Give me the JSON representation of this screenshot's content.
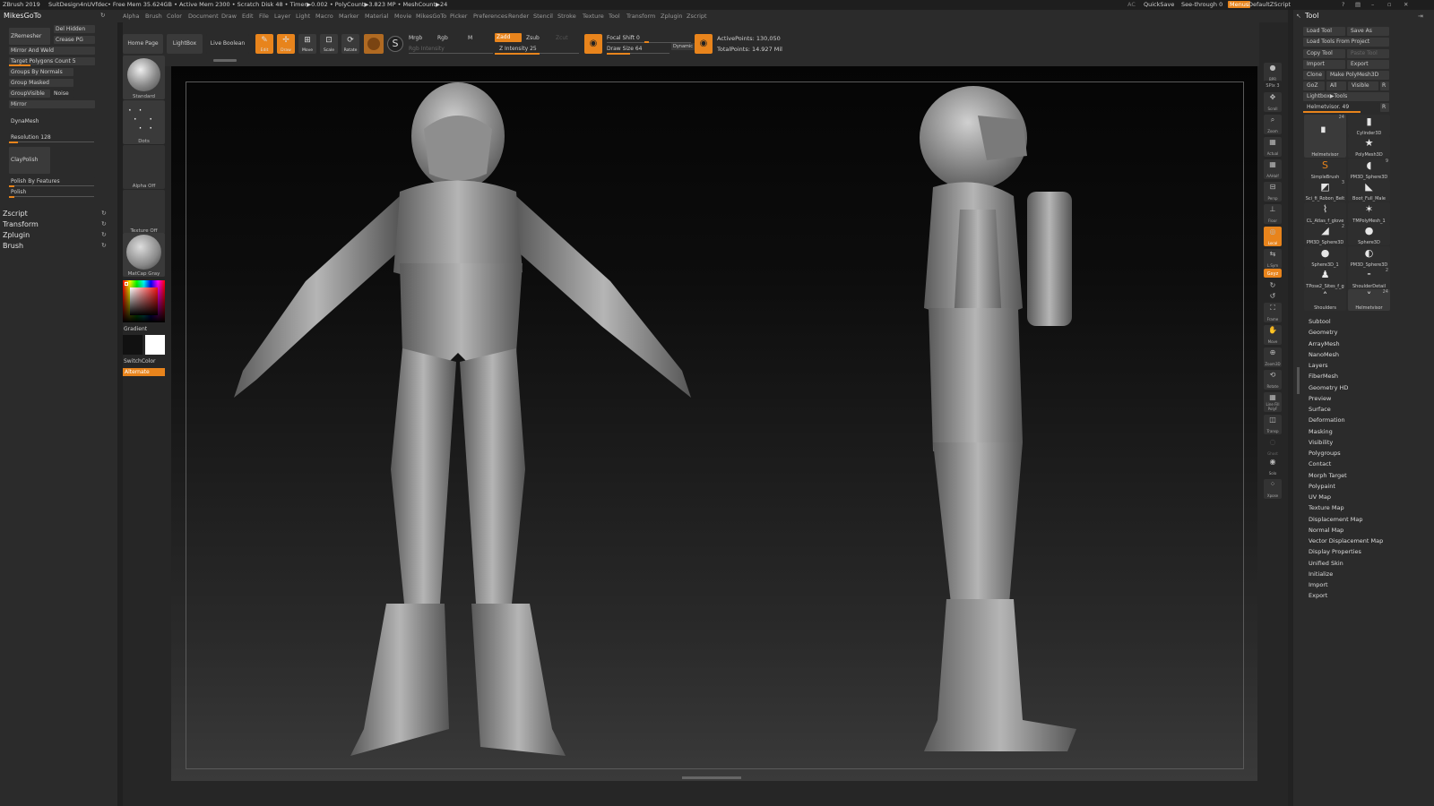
{
  "topbar": {
    "app": "ZBrush 2019",
    "doc": "SuitDesign4nUVfdec",
    "mem": "• Free Mem 35.624GB • Active Mem 2300 • Scratch Disk 48 • Timer▶0.002 • PolyCount▶3.823 MP • MeshCount▶24",
    "ac": "AC",
    "quicksave": "QuickSave",
    "seethrough": "See-through",
    "seethrough_val": "0",
    "menus": "Menus",
    "defaultzscript": "DefaultZScript"
  },
  "menubar": {
    "palette_title": "MikesGoTo",
    "items": [
      "Alpha",
      "Brush",
      "Color",
      "Document",
      "Draw",
      "Edit",
      "File",
      "Layer",
      "Light",
      "Macro",
      "Marker",
      "Material",
      "Movie",
      "MikesGoTo",
      "Picker",
      "Preferences",
      "Render",
      "Stencil",
      "Stroke",
      "Texture",
      "Tool",
      "Transform",
      "Zplugin",
      "Zscript"
    ]
  },
  "left": {
    "zremesher": "ZRemesher",
    "del_hidden": "Del Hidden",
    "crease_pg": "Crease PG",
    "mirror_weld": "Mirror And Weld",
    "target_poly": "Target Polygons Count 5",
    "groups_normals": "Groups By Normals",
    "group_masked": "Group Masked",
    "group_visible": "GroupVisible",
    "noise": "Noise",
    "mirror": "Mirror",
    "dynamesh": "DynaMesh",
    "resolution": "Resolution 128",
    "claypolish": "ClayPolish",
    "polish_features": "Polish By Features",
    "polish": "Polish",
    "menus": [
      "Zscript",
      "Transform",
      "Zplugin",
      "Brush"
    ]
  },
  "shelf": {
    "home": "Home Page",
    "lightbox": "LightBox",
    "live_boolean": "Live Boolean",
    "edit": "Edit",
    "draw": "Draw",
    "move": "Move",
    "scale": "Scale",
    "rotate": "Rotate",
    "mrgb": "Mrgb",
    "rgb": "Rgb",
    "m": "M",
    "rgb_intensity": "Rgb Intensity",
    "zadd": "Zadd",
    "zsub": "Zsub",
    "zcut": "Zcut",
    "z_intensity": "Z Intensity",
    "z_intensity_val": "25",
    "focal_shift": "Focal Shift",
    "focal_shift_val": "0",
    "draw_size": "Draw Size",
    "draw_size_val": "64",
    "dynamic": "Dynamic",
    "active_points": "ActivePoints: 130,050",
    "total_points": "TotalPoints: 14.927 Mil"
  },
  "brushes": {
    "standard": "Standard",
    "dots": "Dots",
    "alpha": "Alpha Off",
    "texture": "Texture Off",
    "material": "MatCap Gray",
    "gradient": "Gradient",
    "switch": "SwitchColor",
    "alternate": "Alternate"
  },
  "rightshelf": [
    "BPR",
    "SPix 3",
    "Scroll",
    "Zoom",
    "Actual",
    "AAHalf",
    "Persp",
    "Floor",
    "Local",
    "L.Sym",
    "Gxyz",
    "",
    "",
    "Frame",
    "Move",
    "Zoom3D",
    "Rotate",
    "Line Fill PolyF",
    "Transp",
    "Ghost",
    "Solo",
    "Xpose"
  ],
  "tool": {
    "title": "Tool",
    "load": "Load Tool",
    "saveas": "Save As",
    "load_project": "Load Tools From Project",
    "copy": "Copy Tool",
    "paste": "Paste Tool",
    "import": "Import",
    "export": "Export",
    "clone": "Clone",
    "make_poly": "Make PolyMesh3D",
    "goz": "GoZ",
    "all": "All",
    "visible": "Visible",
    "r": "R",
    "lightbox_tools": "Lightbox▶Tools",
    "current": "Helmetvisor. 49",
    "thumbs": [
      {
        "n": "Helmetvisor",
        "c": "24",
        "i": "▘"
      },
      {
        "n": "Cylinder3D",
        "c": "",
        "i": "▮"
      },
      {
        "n": "PolyMesh3D",
        "c": "",
        "i": "★"
      },
      {
        "n": "SimpleBrush",
        "c": "",
        "i": "S"
      },
      {
        "n": "PM3D_Sphere3D",
        "c": "9",
        "i": "◖"
      },
      {
        "n": "Sci_fi_Robon_Belt",
        "c": "3",
        "i": "◩"
      },
      {
        "n": "Boot_Full_Male",
        "c": "",
        "i": "◣"
      },
      {
        "n": "CL_Atlas_f_glove",
        "c": "",
        "i": "⌇"
      },
      {
        "n": "TMPolyMesh_1",
        "c": "",
        "i": "✶"
      },
      {
        "n": "PM3D_Sphere3D",
        "c": "2",
        "i": "◢"
      },
      {
        "n": "Sphere3D",
        "c": "",
        "i": "●"
      },
      {
        "n": "Sphere3D_1",
        "c": "",
        "i": "●"
      },
      {
        "n": "PM3D_Sphere3D",
        "c": "",
        "i": "◐"
      },
      {
        "n": "TPose2_Sites_f_g",
        "c": "",
        "i": "♟"
      },
      {
        "n": "ShoulderDetail",
        "c": "2",
        "i": "⁃"
      },
      {
        "n": "Shoulders",
        "c": "",
        "i": "˄"
      },
      {
        "n": "Helmetvisor",
        "c": "24",
        "i": "˅"
      }
    ],
    "subpalettes": [
      "Subtool",
      "Geometry",
      "ArrayMesh",
      "NanoMesh",
      "Layers",
      "FiberMesh",
      "Geometry HD",
      "Preview",
      "Surface",
      "Deformation",
      "Masking",
      "Visibility",
      "Polygroups",
      "Contact",
      "Morph Target",
      "Polypaint",
      "UV Map",
      "Texture Map",
      "Displacement Map",
      "Normal Map",
      "Vector Displacement Map",
      "Display Properties",
      "Unified Skin",
      "Initialize",
      "Import",
      "Export"
    ]
  },
  "colors": {
    "accent": "#e8841c"
  }
}
